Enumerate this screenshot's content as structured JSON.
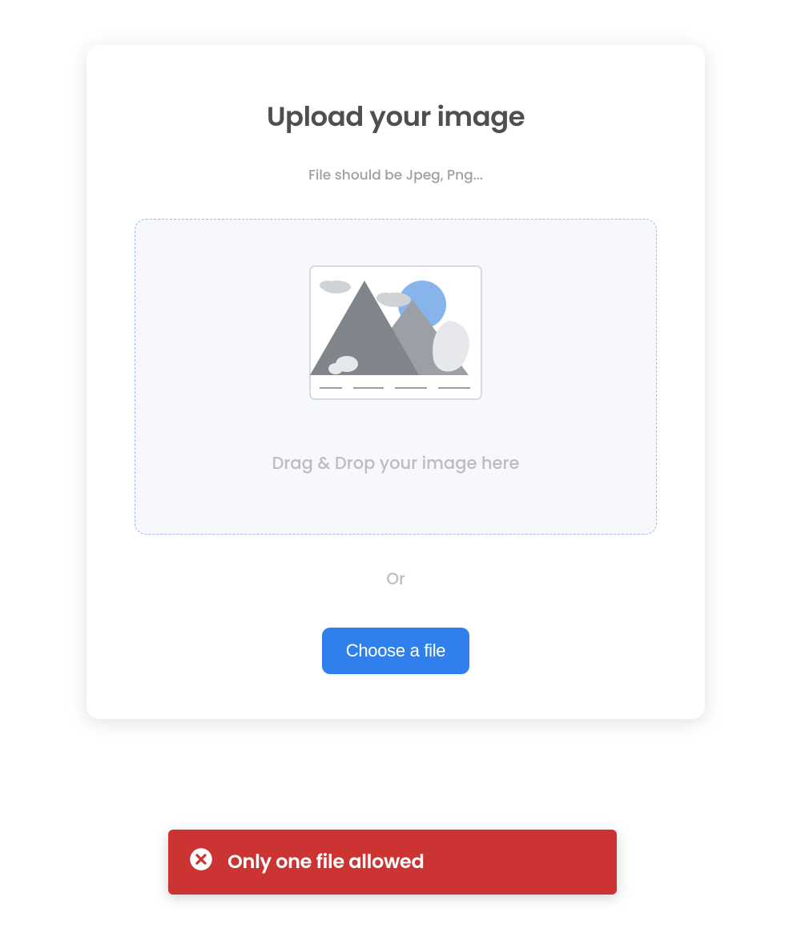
{
  "card": {
    "title": "Upload your image",
    "subtitle": "File should be Jpeg, Png...",
    "dropzone_text": "Drag & Drop your image here",
    "separator": "Or",
    "button_label": "Choose a file"
  },
  "toast": {
    "message": "Only one file allowed",
    "icon": "error-icon"
  },
  "colors": {
    "primary": "#2f80ed",
    "error": "#cc3333",
    "text_dark": "#4f4f4f",
    "text_muted": "#bdbdbd",
    "dropzone_bg": "#f6f8fb",
    "dropzone_border": "#97bef4"
  }
}
